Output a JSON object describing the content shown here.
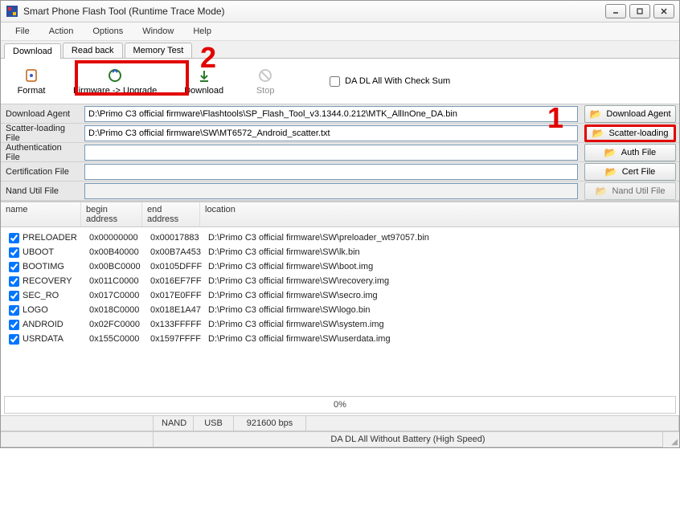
{
  "window": {
    "title": "Smart Phone Flash Tool (Runtime Trace Mode)"
  },
  "menu": {
    "items": [
      "File",
      "Action",
      "Options",
      "Window",
      "Help"
    ]
  },
  "tabs": {
    "items": [
      "Download",
      "Read back",
      "Memory Test"
    ],
    "active_index": 0
  },
  "toolbar": {
    "format": "Format",
    "firmware_upgrade": "Firmware -> Upgrade",
    "download": "Download",
    "stop": "Stop",
    "checksum_label": "DA DL All With Check Sum",
    "checksum_checked": false
  },
  "fields": {
    "download_agent": {
      "label": "Download Agent",
      "value": "D:\\Primo C3 official firmware\\Flashtools\\SP_Flash_Tool_v3.1344.0.212\\MTK_AllInOne_DA.bin",
      "btn": "Download Agent"
    },
    "scatter": {
      "label": "Scatter-loading File",
      "value": "D:\\Primo C3 official firmware\\SW\\MT6572_Android_scatter.txt",
      "btn": "Scatter-loading"
    },
    "auth": {
      "label": "Authentication File",
      "value": "",
      "btn": "Auth File"
    },
    "cert": {
      "label": "Certification File",
      "value": "",
      "btn": "Cert File"
    },
    "nand": {
      "label": "Nand Util File",
      "value": "",
      "btn": "Nand Util File"
    }
  },
  "table": {
    "headers": {
      "name": "name",
      "begin": "begin address",
      "end": "end address",
      "location": "location"
    },
    "rows": [
      {
        "checked": true,
        "name": "PRELOADER",
        "begin": "0x00000000",
        "end": "0x00017883",
        "location": "D:\\Primo C3 official firmware\\SW\\preloader_wt97057.bin"
      },
      {
        "checked": true,
        "name": "UBOOT",
        "begin": "0x00B40000",
        "end": "0x00B7A453",
        "location": "D:\\Primo C3 official firmware\\SW\\lk.bin"
      },
      {
        "checked": true,
        "name": "BOOTIMG",
        "begin": "0x00BC0000",
        "end": "0x0105DFFF",
        "location": "D:\\Primo C3 official firmware\\SW\\boot.img"
      },
      {
        "checked": true,
        "name": "RECOVERY",
        "begin": "0x011C0000",
        "end": "0x016EF7FF",
        "location": "D:\\Primo C3 official firmware\\SW\\recovery.img"
      },
      {
        "checked": true,
        "name": "SEC_RO",
        "begin": "0x017C0000",
        "end": "0x017E0FFF",
        "location": "D:\\Primo C3 official firmware\\SW\\secro.img"
      },
      {
        "checked": true,
        "name": "LOGO",
        "begin": "0x018C0000",
        "end": "0x018E1A47",
        "location": "D:\\Primo C3 official firmware\\SW\\logo.bin"
      },
      {
        "checked": true,
        "name": "ANDROID",
        "begin": "0x02FC0000",
        "end": "0x133FFFFF",
        "location": "D:\\Primo C3 official firmware\\SW\\system.img"
      },
      {
        "checked": true,
        "name": "USRDATA",
        "begin": "0x155C0000",
        "end": "0x1597FFFF",
        "location": "D:\\Primo C3 official firmware\\SW\\userdata.img"
      }
    ]
  },
  "progress": {
    "text": "0%"
  },
  "statusbar": {
    "nand": "NAND",
    "usb": "USB",
    "baud": "921600 bps",
    "mode": "DA DL All Without Battery (High Speed)"
  },
  "annotations": {
    "num1": "1",
    "num2": "2"
  }
}
